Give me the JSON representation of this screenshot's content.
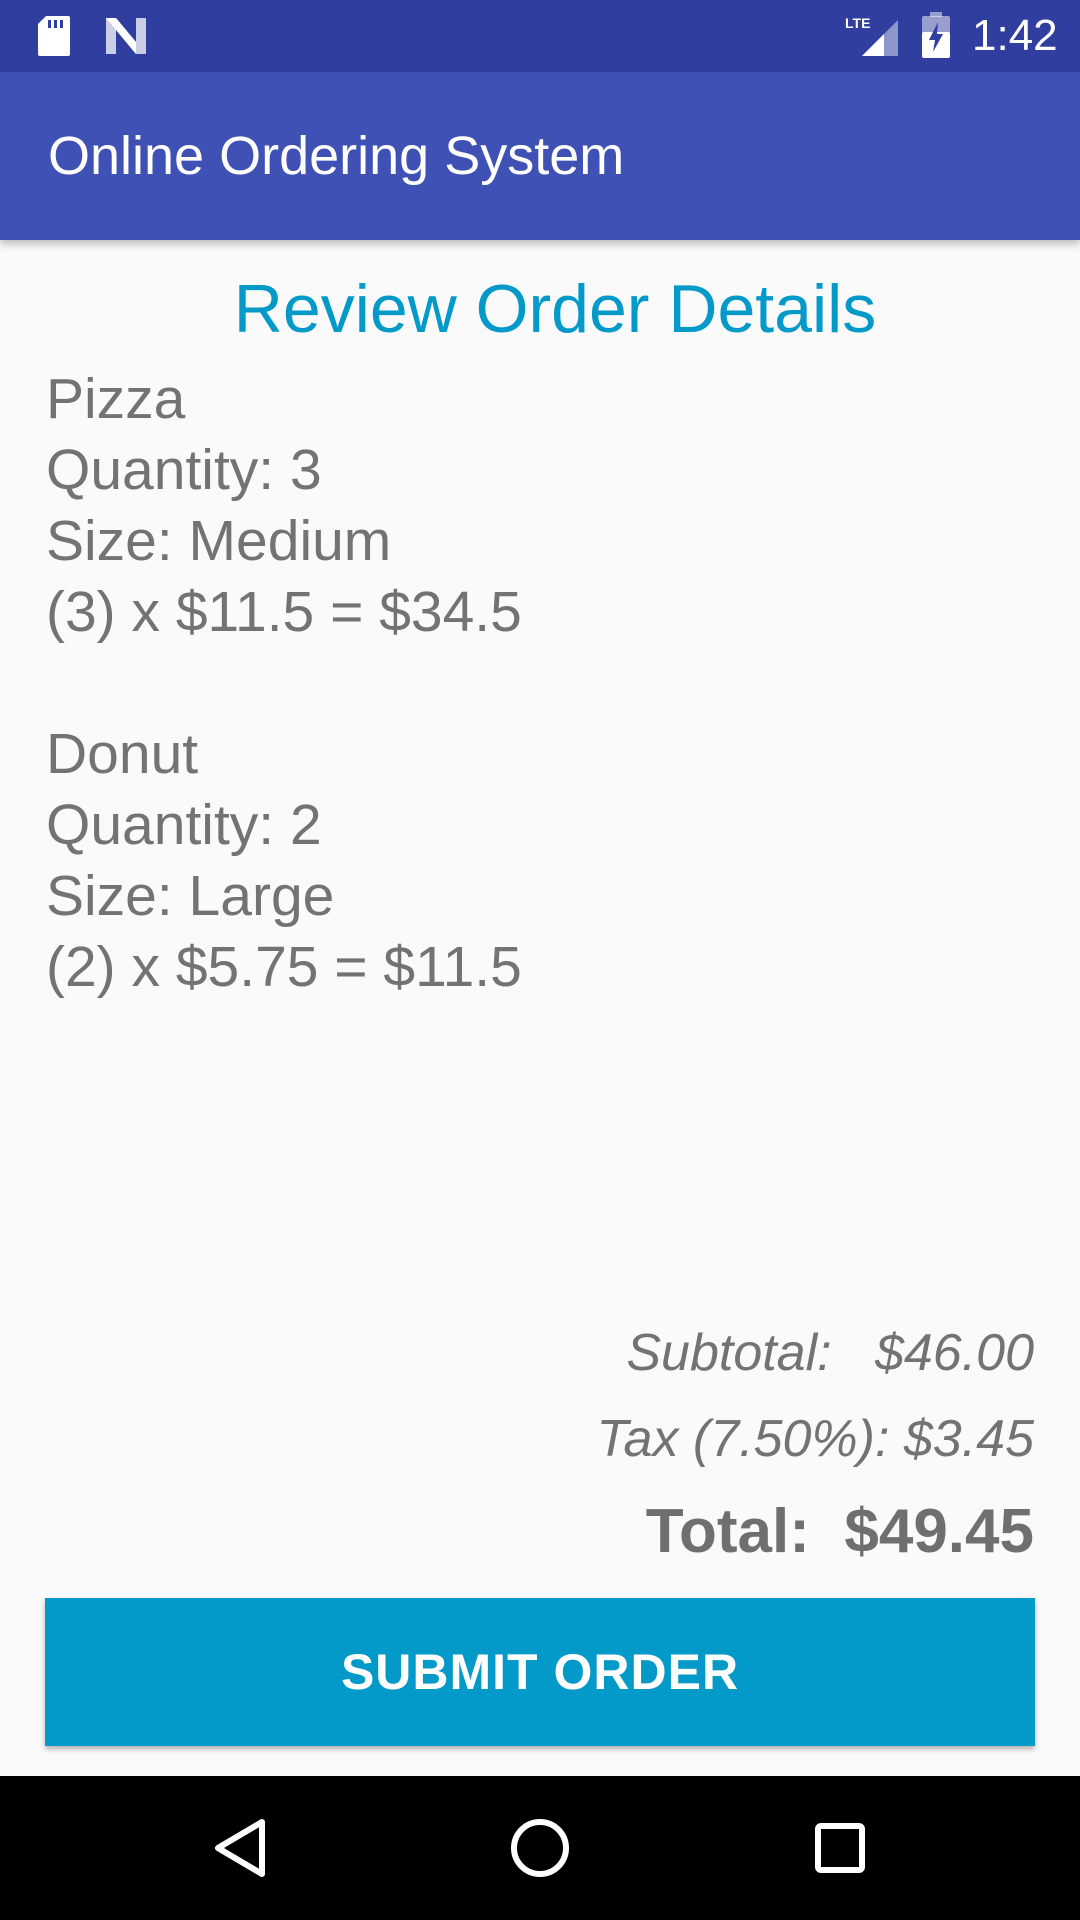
{
  "status_bar": {
    "time": "1:42",
    "lte_label": "LTE",
    "icons": [
      "sd-card-icon",
      "n-icon",
      "lte-signal-icon",
      "battery-charging-icon"
    ]
  },
  "app_bar": {
    "title": "Online Ordering System",
    "color": "#3f51b5"
  },
  "main": {
    "heading": "Review Order Details",
    "items": [
      {
        "name": "Pizza",
        "quantity": "Quantity: 3",
        "size": "Size: Medium",
        "price_line": "(3) x $11.5 = $34.5"
      },
      {
        "name": "Donut",
        "quantity": "Quantity: 2",
        "size": "Size: Large",
        "price_line": "(2) x $5.75 = $11.5"
      }
    ],
    "subtotal": "Subtotal:   $46.00",
    "tax": "Tax (7.50%): $3.45",
    "total": "Total:  $49.45",
    "submit_label": "SUBMIT ORDER",
    "accent_color": "#0399c9"
  },
  "nav_bar": {
    "icons": [
      "back-icon",
      "home-icon",
      "recents-icon"
    ]
  }
}
